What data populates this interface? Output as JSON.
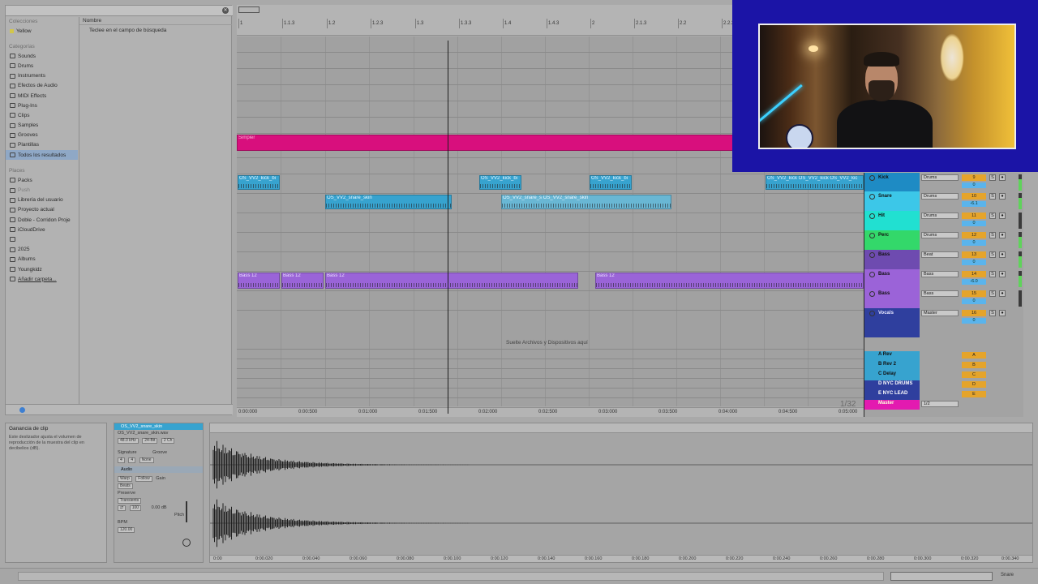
{
  "browser": {
    "collections_header": "Colecciones",
    "collections": [
      {
        "label": "Yellow",
        "color": "#d2c64a"
      }
    ],
    "categories_header": "Categorías",
    "categories": [
      "Sounds",
      "Drums",
      "Instruments",
      "Efectos de Audio",
      "MIDI Effects",
      "Plug-Ins",
      "Clips",
      "Samples",
      "Grooves",
      "Plantillas",
      "Todos los resultados"
    ],
    "places_header": "Places",
    "places": [
      "Packs",
      "Push",
      "Librería del usuario",
      "Proyecto actual",
      "Doble - Corridon Proje",
      "iCloudDrive",
      "",
      "2025",
      "Albums",
      "Youngkidz",
      "Añadir carpeta..."
    ],
    "column_header": "Nombre",
    "search_hint": "Teclee en el campo de búsqueda"
  },
  "arrangement": {
    "ruler_ticks": [
      "1",
      "1.1.3",
      "1.2",
      "1.2.3",
      "1.3",
      "1.3.3",
      "1.4",
      "1.4.3",
      "2",
      "2.1.3",
      "2.2",
      "2.2.3"
    ],
    "time_ticks": [
      "0:00:000",
      "0:00:500",
      "0:01:000",
      "0:01:500",
      "0:02:000",
      "0:02:500",
      "0:03:000",
      "0:03:500",
      "0:04:000",
      "0:04:500",
      "0:05:000"
    ],
    "clips": [
      {
        "label": "Simpler",
        "type": "pink"
      },
      {
        "label": "OS_VV2_kick_bi",
        "type": "blue"
      },
      {
        "label": "OS_VV2_kick_bi",
        "type": "blue"
      },
      {
        "label": "OS_VV2_kick_bi",
        "type": "blue"
      },
      {
        "label": "OS_VV2_kick OS_VV2_kick OS_VV2_kic",
        "type": "blue"
      },
      {
        "label": "OS_VV2_snare_skin",
        "type": "blue"
      },
      {
        "label": "OS_VV2_snare_s OS_VV2_snare_skin",
        "type": "blue"
      },
      {
        "label": "Bass 12",
        "type": "purple"
      },
      {
        "label": "Bass 12",
        "type": "purple"
      },
      {
        "label": "Bass 12",
        "type": "purple"
      },
      {
        "label": "Bass 12",
        "type": "purple"
      }
    ],
    "drop_hint": "Suelte Archivos y Dispositivos aquí",
    "loop_count": "1/32"
  },
  "mixer": {
    "tracks": [
      {
        "name": "Kick",
        "color": "#1e8bc4",
        "route": "Drums",
        "num": "9",
        "vol": "0"
      },
      {
        "name": "Snare",
        "color": "#3cc7e8",
        "route": "Drums",
        "num": "10",
        "vol": "-6.1"
      },
      {
        "name": "Hit",
        "color": "#21e0d1",
        "route": "Drums",
        "num": "11",
        "vol": "0"
      },
      {
        "name": "Perc",
        "color": "#33d86a",
        "route": "Drums",
        "num": "12",
        "vol": "0"
      },
      {
        "name": "Bass",
        "color": "#6e4bb0",
        "route": "Beat",
        "num": "13",
        "vol": "0"
      },
      {
        "name": "Bass",
        "color": "#9b63d8",
        "route": "Bass",
        "num": "14",
        "vol": "-6.0"
      },
      {
        "name": "Bass",
        "color": "#9b63d8",
        "route": "Bass",
        "num": "15",
        "vol": "0"
      },
      {
        "name": "Vocals",
        "color": "#2f3f9e",
        "route": "Master",
        "num": "16",
        "vol": "0"
      }
    ],
    "returns": [
      {
        "name": "A Rev",
        "num": "A"
      },
      {
        "name": "B Rev 2",
        "num": "B"
      },
      {
        "name": "C Delay",
        "num": "C"
      },
      {
        "name": "D NYC DRUMS",
        "num": "D"
      },
      {
        "name": "E NYC LEAD",
        "num": "E"
      },
      {
        "name": "Master",
        "num": "1/2"
      }
    ]
  },
  "info": {
    "title": "Ganancia de clip",
    "text": "Este deslizador ajusta el volumen de reproducción de la muestra del clip en decibelios (dB)."
  },
  "clip_panel": {
    "name": "OS_VV2_snare_skin",
    "file": "OS_VV2_snare_skin.wav",
    "props": [
      "48.0 kHz",
      "24-Bit",
      "2 Ch"
    ],
    "signature_label": "Signature",
    "groove_label": "Groove",
    "sig_num": "4",
    "sig_den": "4",
    "groove": "None",
    "audio_section": "Audio",
    "warp": "Warp",
    "follow": "Follow",
    "mode": "Beats",
    "preserve_label": "Preserve",
    "preserve": "Transients",
    "gain_label": "Gain",
    "gain": "0.00 dB",
    "pitch_label": "Pitch",
    "bpm_label": "BPM",
    "bpm": "120.00",
    "loop_value": "100"
  },
  "sample_view": {
    "time_ticks": [
      "0:00",
      "0:00.020",
      "0:00.040",
      "0:00.060",
      "0:00.080",
      "0:00.100",
      "0:00.120",
      "0:00.140",
      "0:00.160",
      "0:00.180",
      "0:00.200",
      "0:00.220",
      "0:00.240",
      "0:00.260",
      "0:00.280",
      "0:00.300",
      "0:00.320",
      "0:00.340"
    ]
  },
  "status": {
    "label": "Snare"
  }
}
